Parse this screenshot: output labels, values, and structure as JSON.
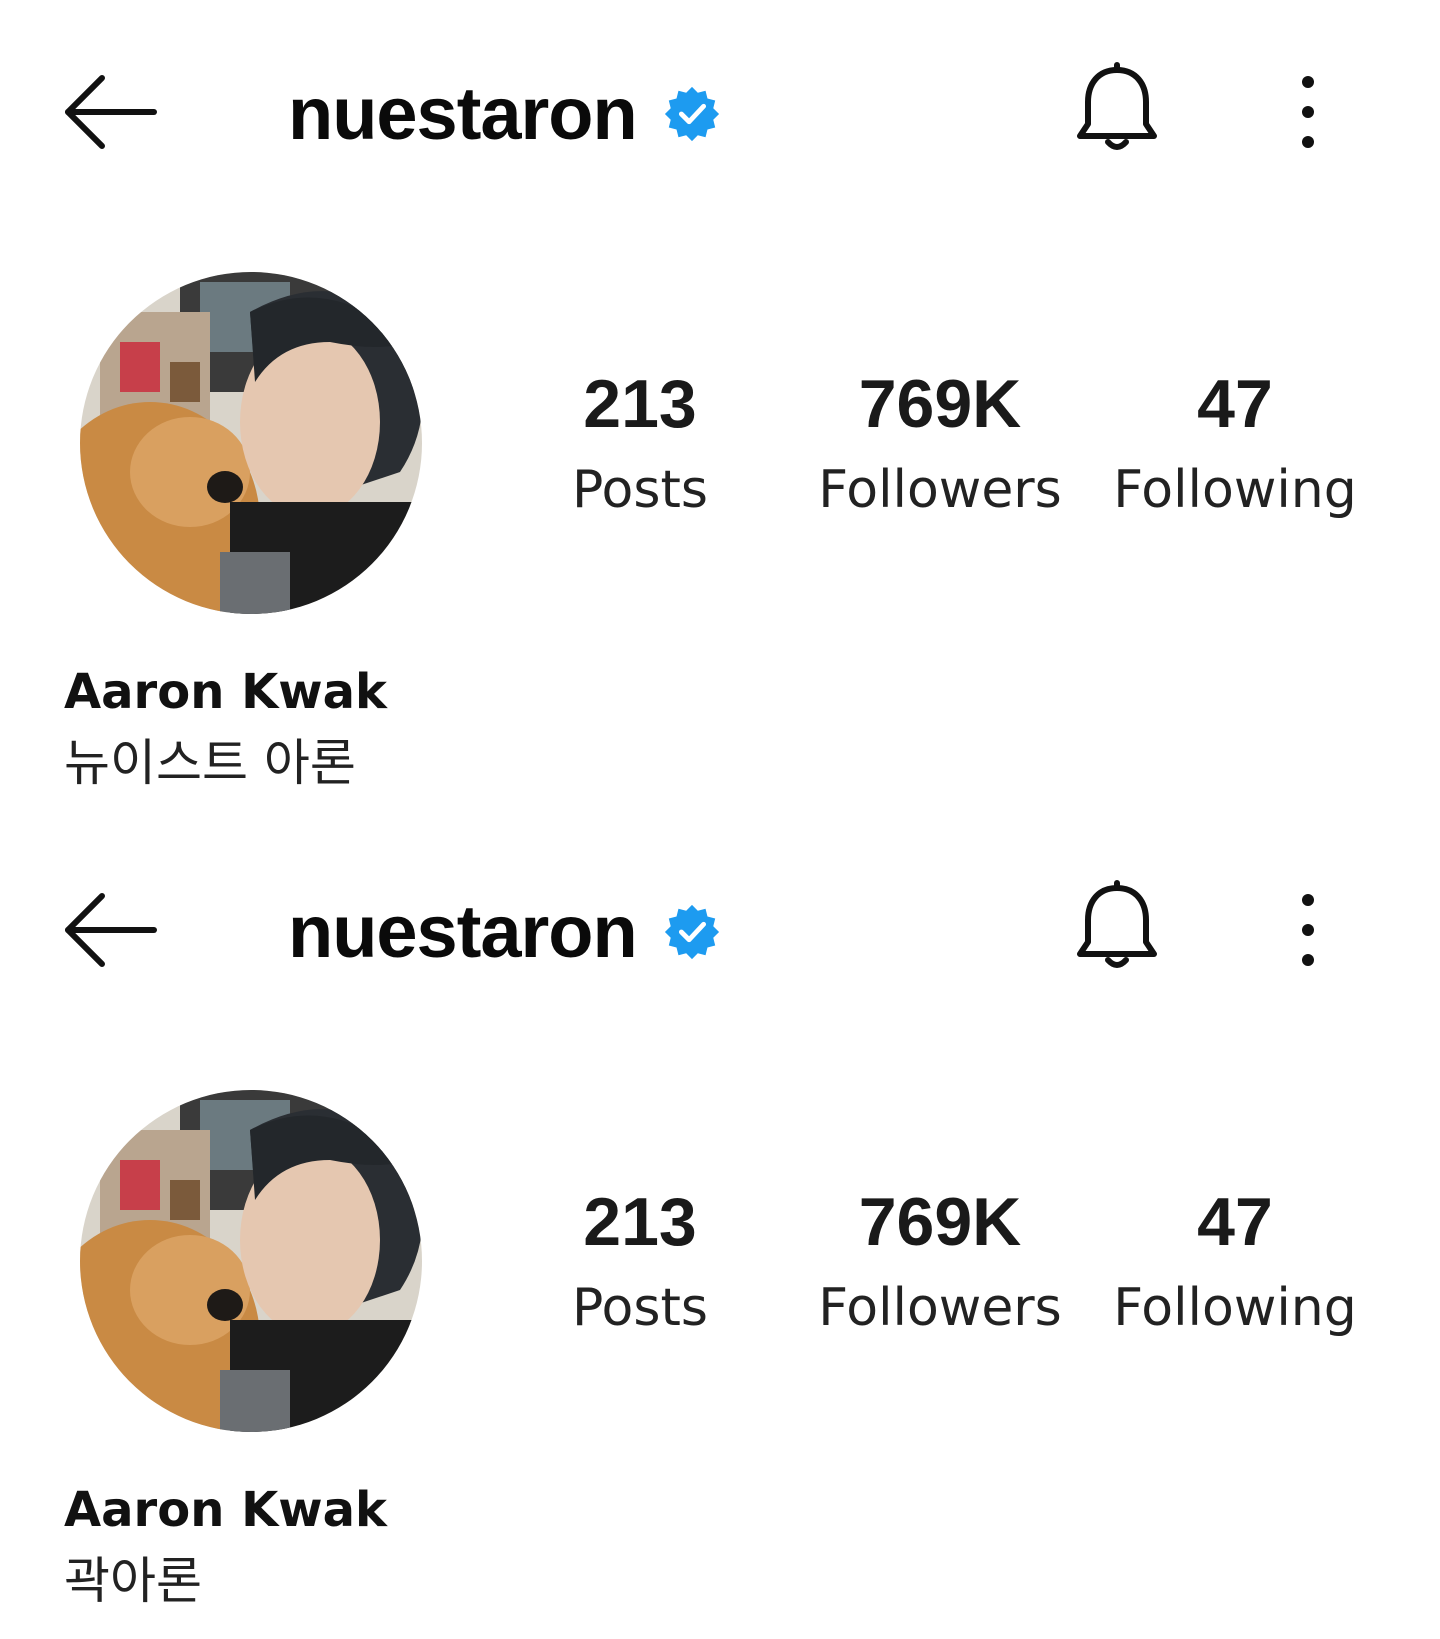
{
  "profiles": [
    {
      "username": "nuestaron",
      "stats": {
        "posts": {
          "value": "213",
          "label": "Posts"
        },
        "followers": {
          "value": "769K",
          "label": "Followers"
        },
        "following": {
          "value": "47",
          "label": "Following"
        }
      },
      "display_name": "Aaron Kwak",
      "bio": "뉴이스트 아론"
    },
    {
      "username": "nuestaron",
      "stats": {
        "posts": {
          "value": "213",
          "label": "Posts"
        },
        "followers": {
          "value": "769K",
          "label": "Followers"
        },
        "following": {
          "value": "47",
          "label": "Following"
        }
      },
      "display_name": "Aaron Kwak",
      "bio": "곽아론"
    }
  ],
  "icons": {
    "back": "back-arrow-icon",
    "verified": "verified-badge-icon",
    "bell": "bell-icon",
    "more": "more-vertical-icon"
  },
  "colors": {
    "verified_blue": "#1d9bf0",
    "text": "#111111",
    "background": "#ffffff"
  }
}
